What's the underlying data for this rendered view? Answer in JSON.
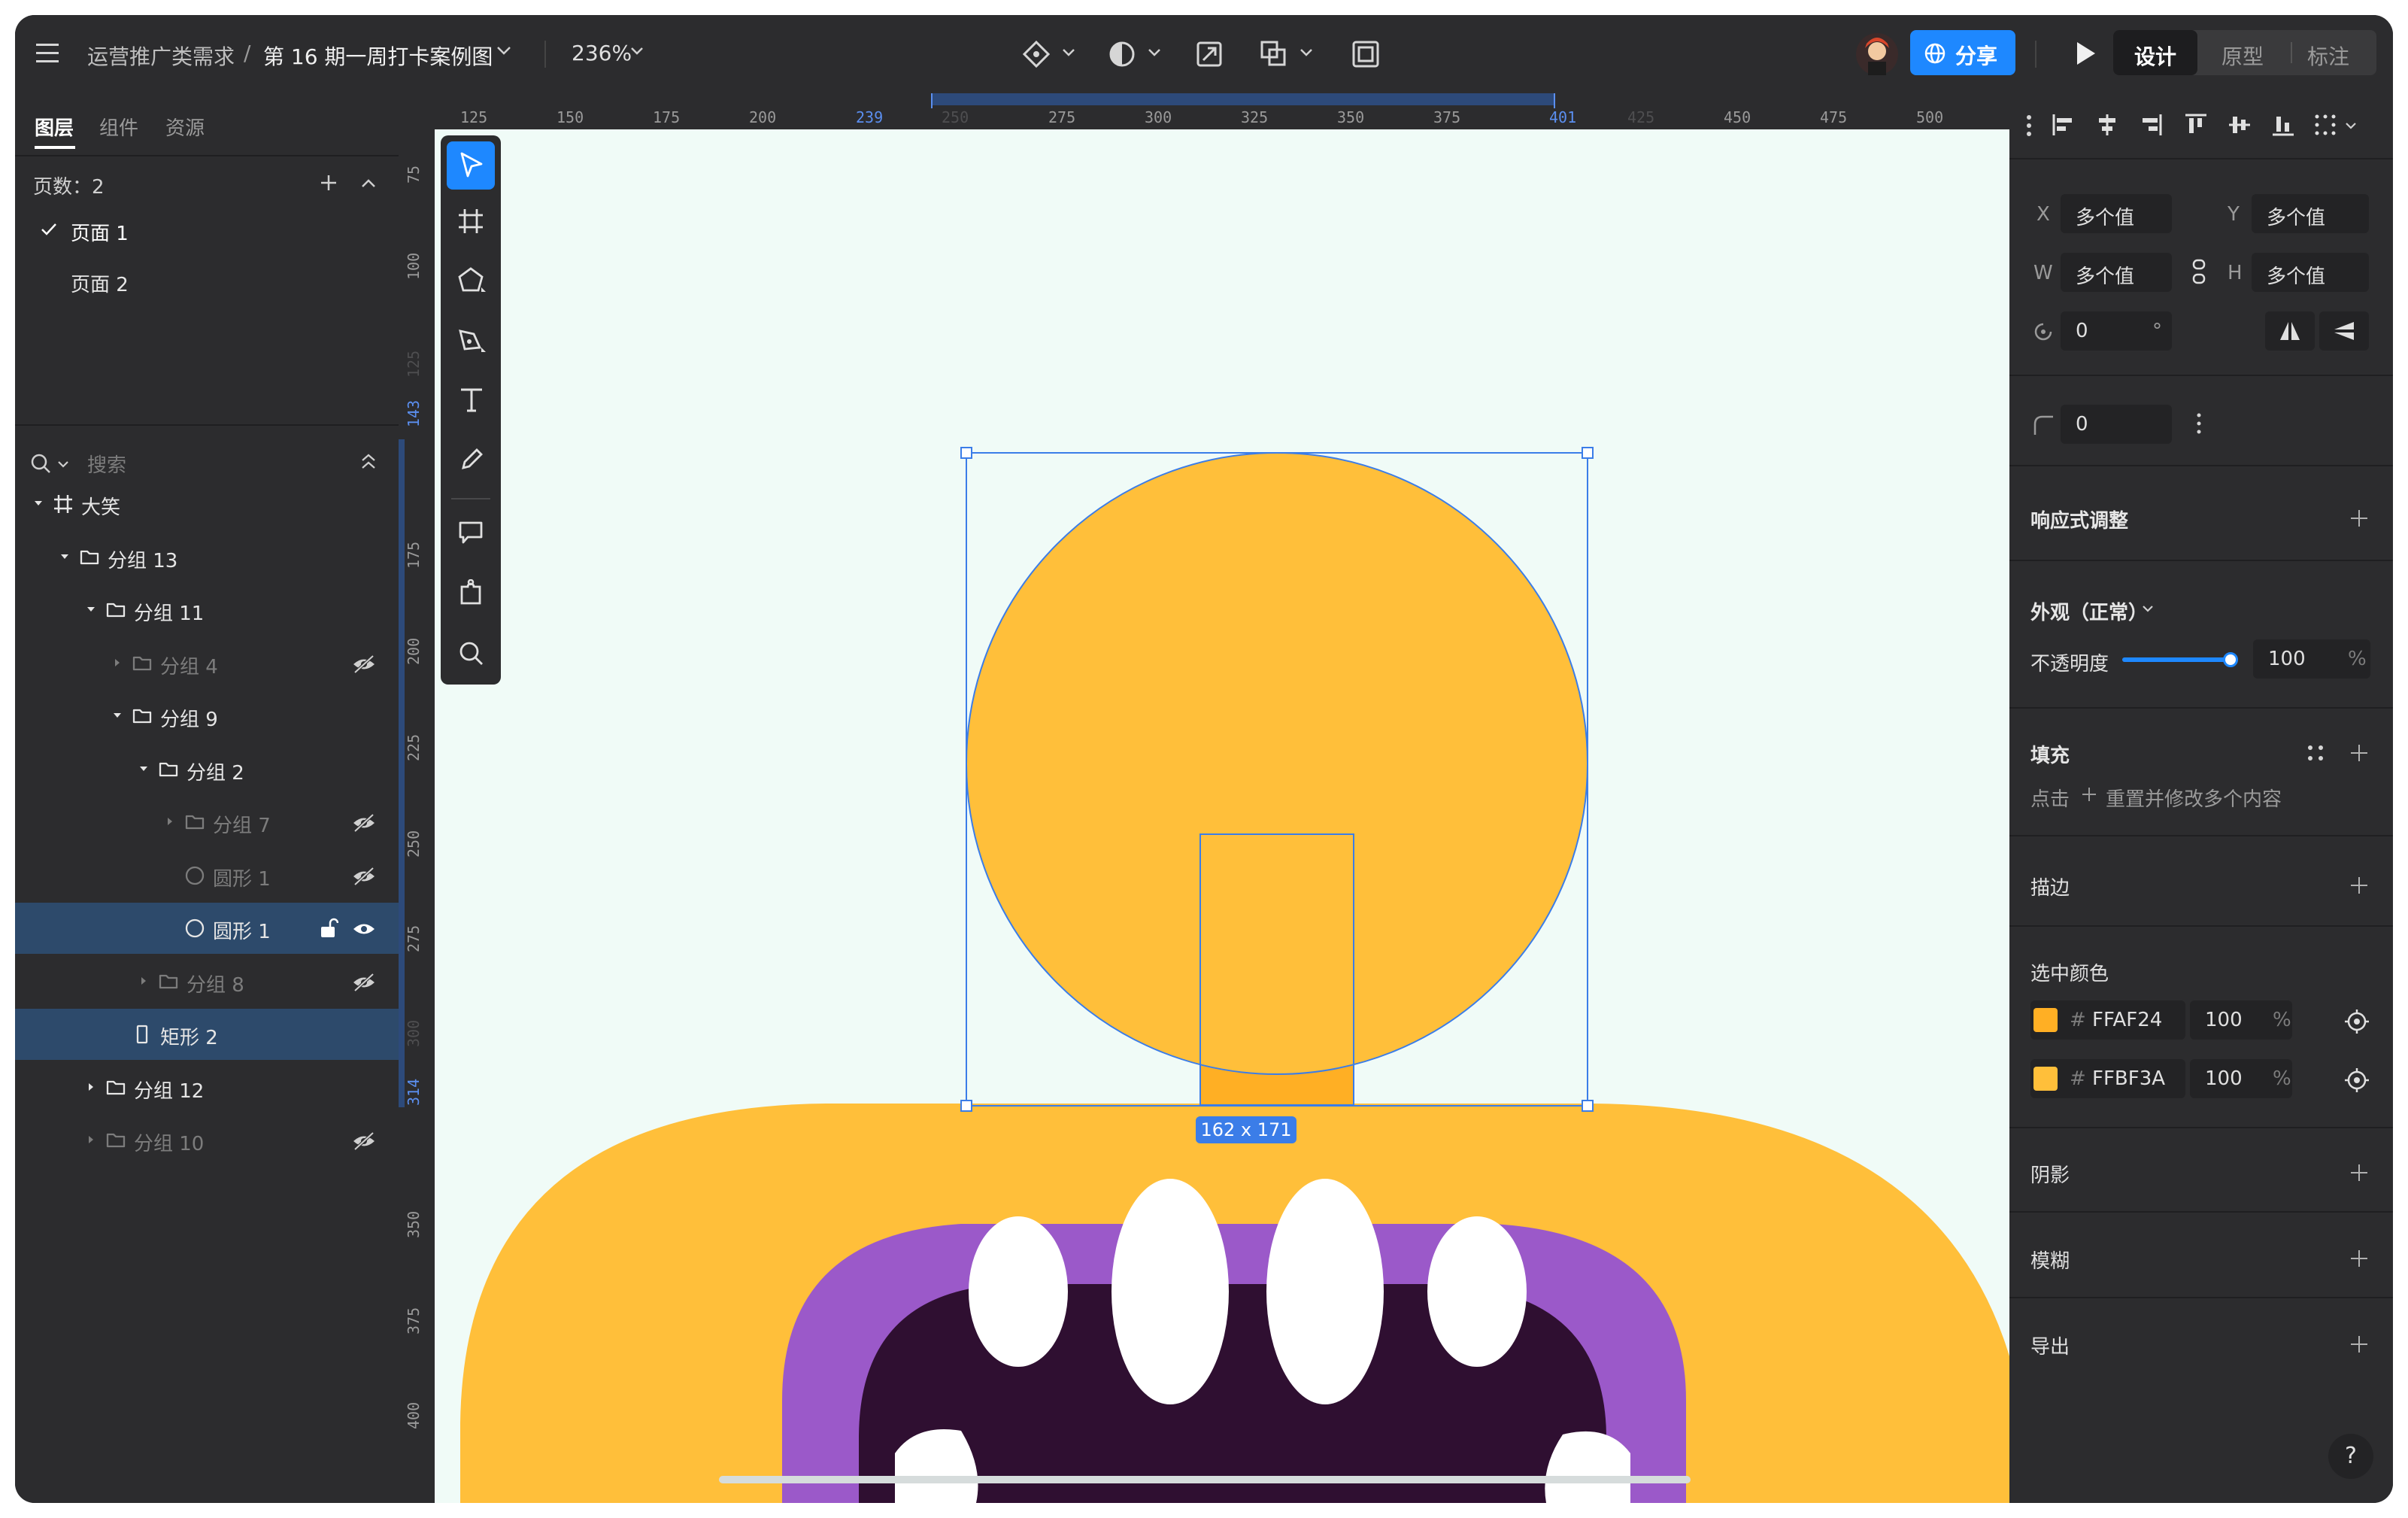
{
  "topbar": {
    "breadcrumb_project": "运营推广类需求",
    "breadcrumb_sep": "/",
    "breadcrumb_file": "第 16 期一周打卡案例图",
    "zoom": "236%",
    "share_label": "分享",
    "mode_tabs": [
      "设计",
      "原型",
      "标注"
    ],
    "active_mode": "设计"
  },
  "left_panel": {
    "tabs": [
      "图层",
      "组件",
      "资源"
    ],
    "active_tab": "图层",
    "pages_label": "页数：2",
    "pages": [
      {
        "label": "页面 1",
        "selected": true
      },
      {
        "label": "页面 2",
        "selected": false
      }
    ],
    "search_placeholder": "搜索",
    "layers": [
      {
        "label": "大笑",
        "type": "frame",
        "expanded": true,
        "dim": false,
        "hidden": false
      },
      {
        "label": "分组 13",
        "type": "group",
        "expanded": true,
        "dim": false,
        "hidden": false
      },
      {
        "label": "分组 11",
        "type": "group",
        "expanded": true,
        "dim": false,
        "hidden": false
      },
      {
        "label": "分组 4",
        "type": "group",
        "expanded": false,
        "dim": true,
        "hidden": true
      },
      {
        "label": "分组 9",
        "type": "group",
        "expanded": true,
        "dim": false,
        "hidden": false
      },
      {
        "label": "分组 2",
        "type": "group",
        "expanded": true,
        "dim": false,
        "hidden": false
      },
      {
        "label": "分组 7",
        "type": "group",
        "expanded": false,
        "dim": true,
        "hidden": true
      },
      {
        "label": "圆形 1",
        "type": "ellipse",
        "expanded": false,
        "dim": true,
        "hidden": true
      },
      {
        "label": "圆形 1",
        "type": "ellipse",
        "expanded": false,
        "dim": false,
        "hidden": false,
        "selected": true
      },
      {
        "label": "分组 8",
        "type": "group",
        "expanded": false,
        "dim": true,
        "hidden": true
      },
      {
        "label": "矩形 2",
        "type": "rect",
        "expanded": false,
        "dim": false,
        "hidden": false,
        "selected": true
      },
      {
        "label": "分组 12",
        "type": "group",
        "expanded": false,
        "dim": false,
        "hidden": false
      },
      {
        "label": "分组 10",
        "type": "group",
        "expanded": false,
        "dim": true,
        "hidden": true
      }
    ]
  },
  "ruler": {
    "top_ticks": [
      "125",
      "150",
      "175",
      "200",
      "239",
      "250",
      "275",
      "300",
      "325",
      "350",
      "375",
      "401",
      "425",
      "450",
      "475",
      "500"
    ],
    "left_ticks": [
      "75",
      "100",
      "125",
      "143",
      "175",
      "200",
      "225",
      "250",
      "275",
      "300",
      "314",
      "350",
      "375",
      "400"
    ]
  },
  "canvas": {
    "selection_size_label": "162 x 171",
    "colors": {
      "background": "#f0fbf7",
      "head": "#ffbf3a",
      "ball": "#ffbf3a",
      "stem": "#ffaf24",
      "lip": "#9b59c9",
      "mouth": "#2f0f31",
      "teeth": "#ffffff",
      "selection": "#3b7de8"
    }
  },
  "right_panel": {
    "x_label": "X",
    "x_value": "多个值",
    "y_label": "Y",
    "y_value": "多个值",
    "w_label": "W",
    "w_value": "多个值",
    "h_label": "H",
    "h_value": "多个值",
    "rotation_value": "0",
    "rotation_unit": "°",
    "radius_value": "0",
    "responsive_label": "响应式调整",
    "appearance_label": "外观（正常）",
    "opacity_label": "不透明度",
    "opacity_value": "100",
    "opacity_unit": "%",
    "opacity_level": 1.0,
    "fill_label": "填充",
    "fill_hint_click": "点击",
    "fill_hint_text": "重置并修改多个内容",
    "stroke_label": "描边",
    "selected_colors_label": "选中颜色",
    "selected_colors": [
      {
        "hex": "FFAF24",
        "swatch": "#ffaf24",
        "opacity": "100",
        "unit": "%"
      },
      {
        "hex": "FFBF3A",
        "swatch": "#ffbf3a",
        "opacity": "100",
        "unit": "%"
      }
    ],
    "hash": "#",
    "shadow_label": "阴影",
    "blur_label": "模糊",
    "export_label": "导出",
    "help_label": "?"
  }
}
